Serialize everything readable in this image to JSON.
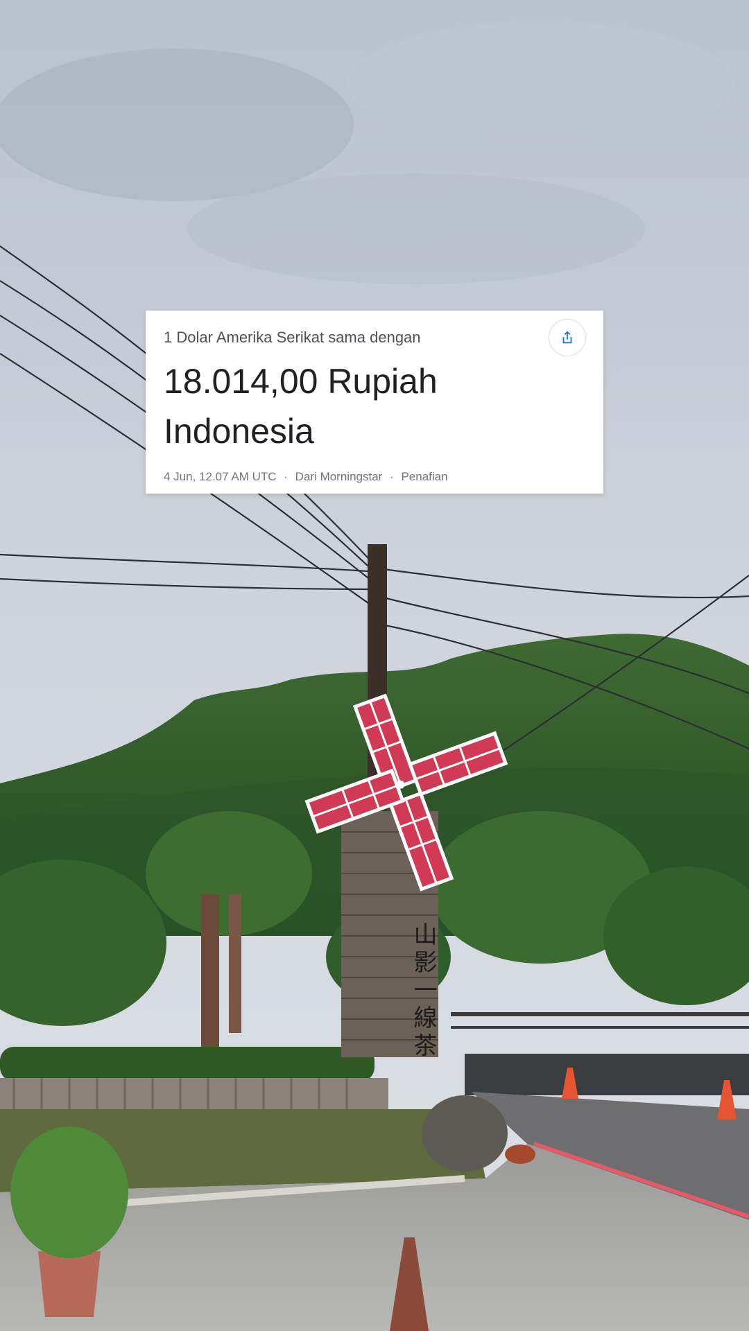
{
  "converter": {
    "label": "1 Dolar Amerika Serikat sama dengan",
    "result": "18.014,00 Rupiah Indonesia",
    "timestamp": "4 Jun, 12.07 AM UTC",
    "source": "Dari Morningstar",
    "disclaimer": "Penafian",
    "separator": "·",
    "share_icon": "share-icon"
  },
  "background": {
    "sign_text": "山影一線茶",
    "colors": {
      "sky": "#c9cfd8",
      "mountain": "#2f5a2a",
      "windmill_red": "#d03a55",
      "road": "#6e6e70"
    }
  },
  "colors": {
    "card_bg": "#ffffff",
    "accent": "#1a73e8",
    "text_primary": "#202124",
    "text_secondary": "#4d5156"
  }
}
